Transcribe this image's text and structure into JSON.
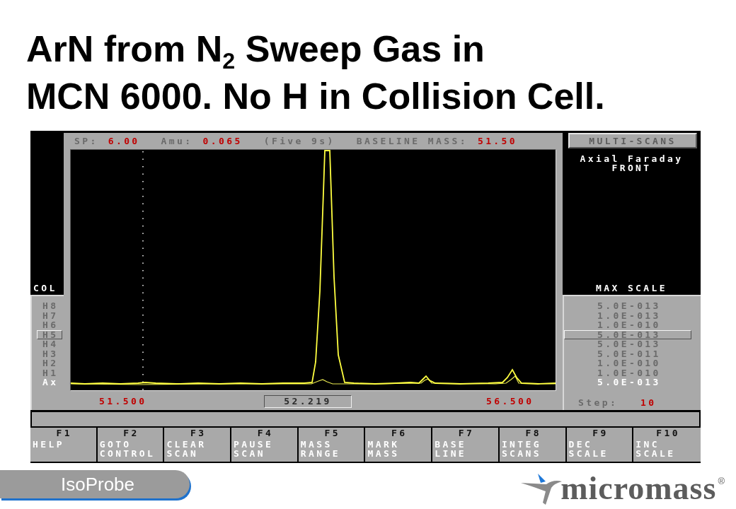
{
  "title": {
    "lines": [
      "ArN from N$_{2}$ Sweep Gas in",
      "MCN 6000. No H in Collision Cell."
    ]
  },
  "screen": {
    "header": [
      {
        "label": "SP:",
        "value": "6.00"
      },
      {
        "label": "Amu:",
        "value": "0.065"
      },
      {
        "label": "(Five 9s)"
      },
      {
        "label": "BASELINE MASS:",
        "value": "51.50"
      }
    ],
    "collector_panel": {
      "heading": "COL",
      "collectors": [
        {
          "name": "H8",
          "selected": false,
          "highlighted": false
        },
        {
          "name": "H7",
          "selected": false,
          "highlighted": false
        },
        {
          "name": "H6",
          "selected": false,
          "highlighted": false
        },
        {
          "name": "H5",
          "selected": true,
          "highlighted": false
        },
        {
          "name": "H4",
          "selected": false,
          "highlighted": false
        },
        {
          "name": "H3",
          "selected": false,
          "highlighted": false
        },
        {
          "name": "H2",
          "selected": false,
          "highlighted": false
        },
        {
          "name": "H1",
          "selected": false,
          "highlighted": false
        },
        {
          "name": "Ax",
          "selected": false,
          "highlighted": true
        }
      ]
    },
    "spectrum": {
      "mass_start": "51.500",
      "cursor_mass": "52.219",
      "mass_end": "56.500"
    },
    "mode_button": "MULTI-SCANS",
    "detector": [
      "Axial Faraday",
      "FRONT"
    ],
    "scale_panel": {
      "heading": "MAX SCALE",
      "scales": [
        {
          "value": "5.0E-013",
          "selected": false,
          "highlighted": false
        },
        {
          "value": "1.0E-013",
          "selected": false,
          "highlighted": false
        },
        {
          "value": "1.0E-010",
          "selected": false,
          "highlighted": false
        },
        {
          "value": "5.0E-013",
          "selected": true,
          "highlighted": false
        },
        {
          "value": "5.0E-013",
          "selected": false,
          "highlighted": false
        },
        {
          "value": "5.0E-011",
          "selected": false,
          "highlighted": false
        },
        {
          "value": "1.0E-010",
          "selected": false,
          "highlighted": false
        },
        {
          "value": "1.0E-010",
          "selected": false,
          "highlighted": false
        },
        {
          "value": "5.0E-013",
          "selected": false,
          "highlighted": true
        }
      ],
      "step_label": "Step:",
      "step_value": "10"
    },
    "function_keys": [
      {
        "key": "F1",
        "label": [
          "HELP"
        ]
      },
      {
        "key": "F2",
        "label": [
          "GOTO",
          "CONTROL"
        ]
      },
      {
        "key": "F3",
        "label": [
          "CLEAR",
          "SCAN"
        ]
      },
      {
        "key": "F4",
        "label": [
          "PAUSE",
          "SCAN"
        ]
      },
      {
        "key": "F5",
        "label": [
          "MASS",
          "RANGE"
        ]
      },
      {
        "key": "F6",
        "label": [
          "MARK",
          "MASS"
        ]
      },
      {
        "key": "F7",
        "label": [
          "BASE",
          "LINE"
        ]
      },
      {
        "key": "F8",
        "label": [
          "INTEG",
          "SCANS"
        ]
      },
      {
        "key": "F9",
        "label": [
          "DEC",
          "SCALE"
        ]
      },
      {
        "key": "F10",
        "label": [
          "INC",
          "SCALE"
        ]
      }
    ]
  },
  "footer": {
    "product": "IsoProbe",
    "logo": {
      "text": "micromass",
      "mark": "®"
    }
  }
}
